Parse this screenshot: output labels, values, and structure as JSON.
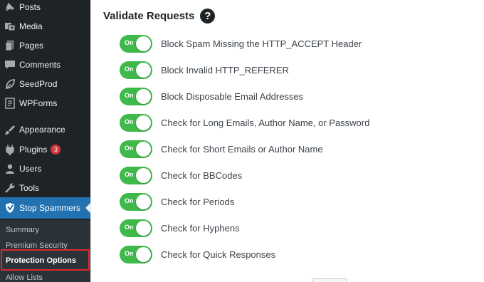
{
  "sidebar": {
    "items": [
      {
        "label": "Posts",
        "icon": "pin-icon",
        "badge": null
      },
      {
        "label": "Media",
        "icon": "media-icon",
        "badge": null
      },
      {
        "label": "Pages",
        "icon": "pages-icon",
        "badge": null
      },
      {
        "label": "Comments",
        "icon": "comments-icon",
        "badge": null
      },
      {
        "label": "SeedProd",
        "icon": "seedprod-icon",
        "badge": null
      },
      {
        "label": "WPForms",
        "icon": "wpforms-icon",
        "badge": null
      },
      {
        "label": "Appearance",
        "icon": "appearance-icon",
        "badge": null
      },
      {
        "label": "Plugins",
        "icon": "plugins-icon",
        "badge": "3"
      },
      {
        "label": "Users",
        "icon": "users-icon",
        "badge": null
      },
      {
        "label": "Tools",
        "icon": "tools-icon",
        "badge": null
      },
      {
        "label": "Stop Spammers",
        "icon": "shield-icon",
        "badge": null
      }
    ],
    "submenu": [
      {
        "label": "Summary"
      },
      {
        "label": "Premium Security"
      },
      {
        "label": "Protection Options"
      },
      {
        "label": "Allow Lists"
      }
    ]
  },
  "panel": {
    "title": "Validate Requests",
    "help_glyph": "?",
    "toggle_text": "On",
    "options": [
      {
        "label": "Block Spam Missing the HTTP_ACCEPT Header",
        "on": true
      },
      {
        "label": "Block Invalid HTTP_REFERER",
        "on": true
      },
      {
        "label": "Block Disposable Email Addresses",
        "on": true
      },
      {
        "label": "Check for Long Emails, Author Name, or Password",
        "on": true
      },
      {
        "label": "Check for Short Emails or Author Name",
        "on": true
      },
      {
        "label": "Check for BBCodes",
        "on": true
      },
      {
        "label": "Check for Periods",
        "on": true
      },
      {
        "label": "Check for Hyphens",
        "on": true
      },
      {
        "label": "Check for Quick Responses",
        "on": true
      }
    ]
  },
  "colors": {
    "sidebar_bg": "#1d2327",
    "active_bg": "#2271b1",
    "toggle_on": "#3fb94a",
    "badge": "#d63638",
    "highlight": "#e0282e"
  }
}
